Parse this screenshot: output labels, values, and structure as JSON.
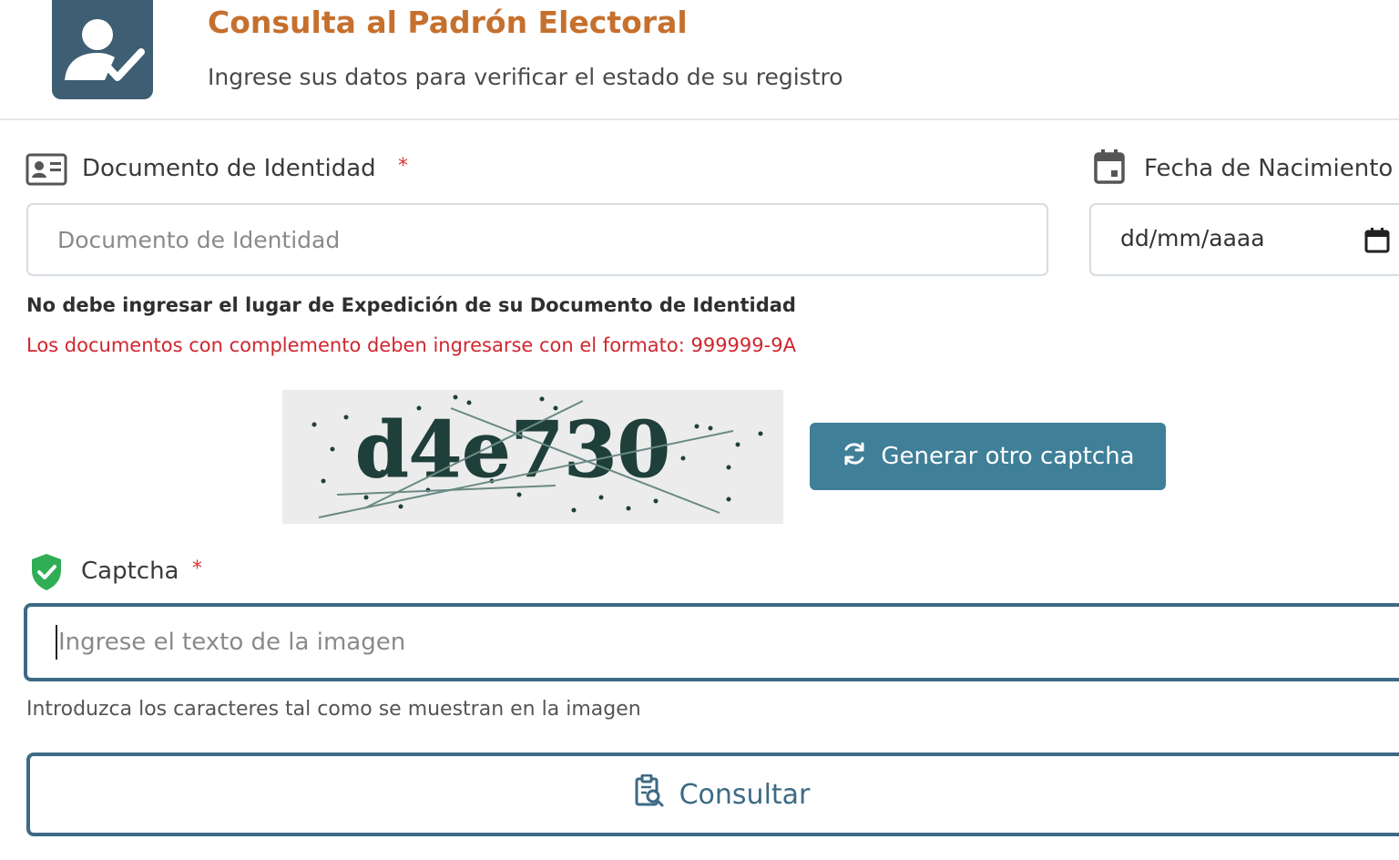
{
  "header": {
    "title": "Consulta al Padrón Electoral",
    "subtitle": "Ingrese sus datos para verificar el estado de su registro",
    "logo_icon": "user-check-icon"
  },
  "document_field": {
    "label": "Documento de Identidad",
    "required_mark": "*",
    "placeholder": "Documento de Identidad",
    "value": "",
    "icon": "id-card-icon"
  },
  "birthdate_field": {
    "label": "Fecha de Nacimiento",
    "display_value": "dd/mm/aaaa",
    "icon": "calendar-icon"
  },
  "notes": {
    "bold": "No debe ingresar el lugar de Expedición de su Documento de Identidad",
    "red": "Los documentos con complemento deben ingresarse con el formato: 999999-9A"
  },
  "captcha": {
    "image_text": "d4e730",
    "regenerate_label": "Generar otro captcha",
    "label": "Captcha",
    "required_mark": "*",
    "placeholder": "Ingrese el texto de la imagen",
    "value": "",
    "helper": "Introduzca los caracteres tal como se muestran en la imagen",
    "icon": "shield-check-icon"
  },
  "submit": {
    "label": "Consultar",
    "icon": "clipboard-search-icon"
  },
  "colors": {
    "brand": "#3d5e73",
    "title": "#c6702e",
    "accent": "#3f7f98",
    "error": "#d0262e",
    "success": "#2fae55"
  }
}
